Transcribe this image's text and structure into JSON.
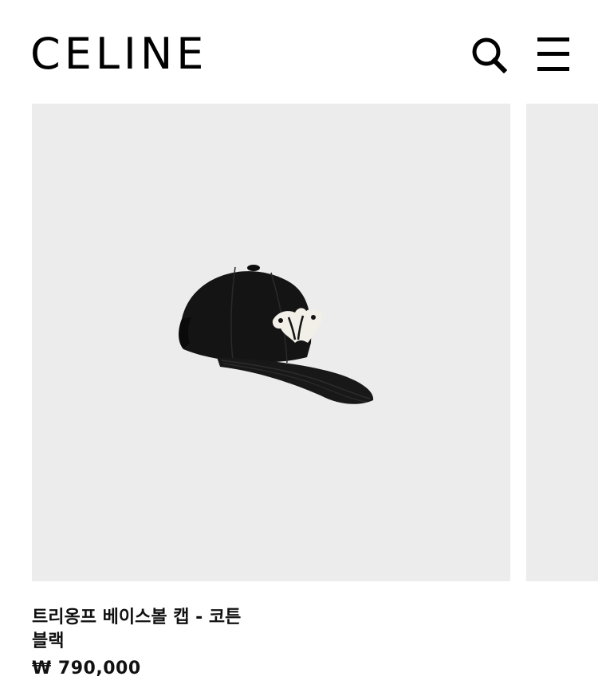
{
  "header": {
    "logo": "CELINE",
    "search_icon": "search-icon",
    "menu_icon": "hamburger-menu-icon"
  },
  "product": {
    "image_subject": "black-baseball-cap-with-white-triomphe-logo",
    "name": "트리옹프 베이스볼 캡 - 코튼",
    "color": "블랙",
    "price": "₩ 790,000"
  },
  "colors": {
    "background": "#ffffff",
    "image_bg": "#ececec",
    "text": "#111111",
    "cap": "#141414",
    "logo_patch": "#f2efe8"
  }
}
